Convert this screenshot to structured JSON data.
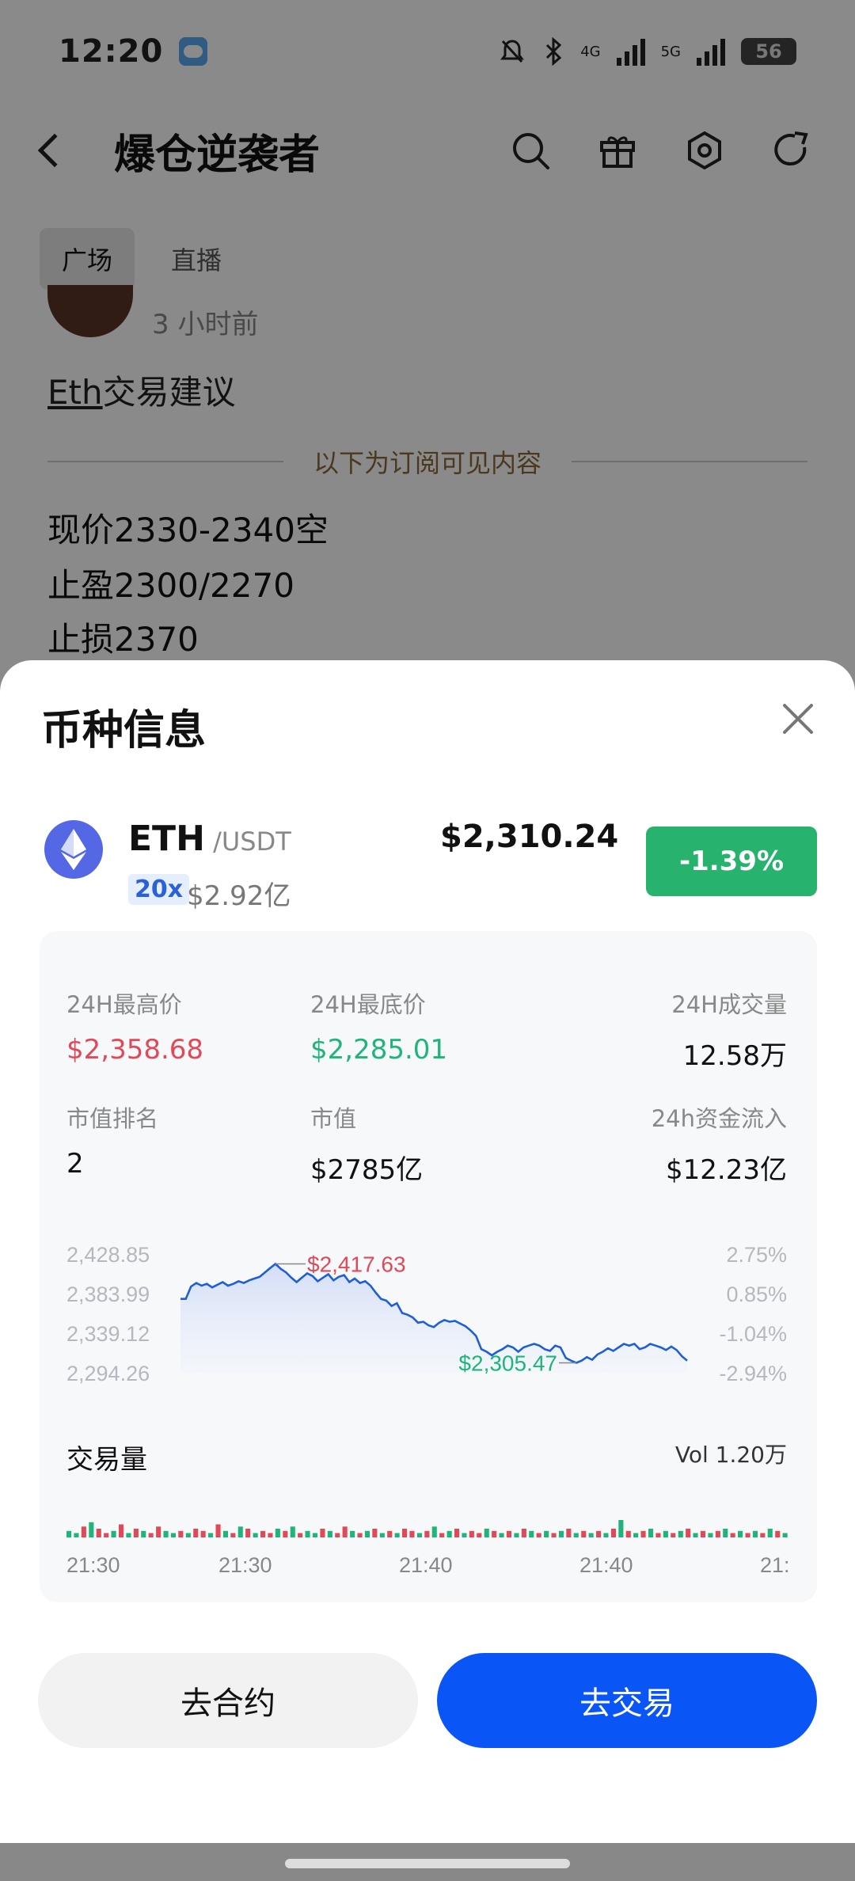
{
  "status_bar": {
    "time": "12:20",
    "battery": "56",
    "net1": "4G",
    "net2": "5G"
  },
  "nav": {
    "title": "爆仓逆袭者"
  },
  "tabs": [
    {
      "label": "广场"
    },
    {
      "label": "直播"
    }
  ],
  "post": {
    "time_ago": "3 小时前",
    "title_underlined": "Eth",
    "title_rest": "交易建议",
    "divider_text": "以下为订阅可见内容",
    "lines": [
      "现价2330-2340空",
      "止盈2300/2270",
      "止损2370"
    ]
  },
  "sheet": {
    "title": "币种信息",
    "coin": {
      "symbol": "ETH",
      "pair": " /USDT",
      "leverage": "20x",
      "market_cap_short": "$2.92亿",
      "price": "$2,310.24",
      "change": "-1.39%"
    },
    "stats": {
      "high_label": "24H最高价",
      "high_value": "$2,358.68",
      "low_label": "24H最底价",
      "low_value": "$2,285.01",
      "vol_label": "24H成交量",
      "vol_value": "12.58万",
      "rank_label": "市值排名",
      "rank_value": "2",
      "mcap_label": "市值",
      "mcap_value": "$2785亿",
      "inflow_label": "24h资金流入",
      "inflow_value": "$12.23亿"
    },
    "volume": {
      "label": "交易量",
      "value": "Vol 1.20万"
    },
    "buttons": {
      "contract": "去合约",
      "trade": "去交易"
    }
  },
  "chart_data": {
    "type": "line",
    "y_ticks_left": [
      "2,428.85",
      "2,383.99",
      "2,339.12",
      "2,294.26"
    ],
    "y_ticks_right": [
      "2.75%",
      "0.85%",
      "-1.04%",
      "-2.94%"
    ],
    "ylim": [
      2294.26,
      2428.85
    ],
    "max_label": "$2,417.63",
    "min_label": "$2,305.47",
    "max_value": 2417.63,
    "min_value": 2305.47,
    "x_ticks": [
      "21:30",
      "21:30",
      "21:40",
      "21:40",
      "21:"
    ],
    "series": [
      {
        "values": [
          2378,
          2378,
          2392,
          2396,
          2393,
          2395,
          2391,
          2394,
          2397,
          2393,
          2395,
          2398,
          2396,
          2399,
          2401,
          2403,
          2408,
          2413,
          2417.63,
          2412,
          2408,
          2402,
          2397,
          2402,
          2407,
          2404,
          2398,
          2402,
          2406,
          2399,
          2403,
          2405,
          2397,
          2401,
          2396,
          2398,
          2393,
          2385,
          2378,
          2376,
          2370,
          2373,
          2362,
          2360,
          2357,
          2351,
          2352,
          2348,
          2346,
          2351,
          2354,
          2352,
          2353,
          2350,
          2347,
          2342,
          2336,
          2321,
          2318,
          2314,
          2318,
          2321,
          2325,
          2323,
          2318,
          2323,
          2325,
          2327,
          2325,
          2321,
          2319,
          2325,
          2323,
          2311,
          2308,
          2305.47,
          2308,
          2312,
          2309,
          2315,
          2318,
          2322,
          2319,
          2323,
          2327,
          2325,
          2327,
          2321,
          2323,
          2327,
          2325,
          2323,
          2320,
          2324,
          2320,
          2313,
          2308
        ]
      }
    ],
    "volumes": [
      3,
      2,
      5,
      7,
      4,
      2,
      3,
      6,
      2,
      4,
      3,
      2,
      5,
      3,
      2,
      3,
      2,
      4,
      3,
      2,
      6,
      3,
      2,
      5,
      4,
      2,
      3,
      2,
      4,
      3,
      5,
      2,
      3,
      2,
      4,
      3,
      2,
      5,
      3,
      2,
      3,
      4,
      2,
      3,
      2,
      4,
      3,
      2,
      3,
      5,
      2,
      3,
      4,
      2,
      3,
      2,
      4,
      3,
      2,
      3,
      2,
      4,
      3,
      2,
      3,
      2,
      3,
      4,
      2,
      3,
      2,
      3,
      2,
      4,
      8,
      3,
      2,
      3,
      4,
      2,
      3,
      2,
      3,
      4,
      2,
      3,
      2,
      3,
      4,
      2,
      3,
      2,
      3,
      2,
      4,
      3,
      2
    ],
    "volume_directions": [
      "g",
      "g",
      "r",
      "g",
      "r",
      "r",
      "g",
      "r",
      "g",
      "r",
      "g",
      "r",
      "r",
      "g",
      "g",
      "r",
      "g",
      "r",
      "r",
      "g",
      "r",
      "g",
      "r",
      "g",
      "r",
      "g",
      "r",
      "r",
      "g",
      "r",
      "g",
      "r",
      "g",
      "g",
      "r",
      "g",
      "r",
      "r",
      "g",
      "r",
      "g",
      "r",
      "g",
      "r",
      "g",
      "r",
      "r",
      "g",
      "r",
      "g",
      "r",
      "g",
      "r",
      "g",
      "r",
      "r",
      "g",
      "r",
      "g",
      "r",
      "g",
      "r",
      "g",
      "r",
      "g",
      "r",
      "g",
      "r",
      "g",
      "r",
      "g",
      "r",
      "g",
      "r",
      "g",
      "r",
      "g",
      "r",
      "g",
      "r",
      "g",
      "r",
      "g",
      "r",
      "g",
      "r",
      "g",
      "r",
      "g",
      "r",
      "g",
      "r",
      "g",
      "r",
      "g",
      "r",
      "g"
    ],
    "colors": {
      "line": "#1e5fd6",
      "up": "#1fb57a",
      "down": "#e04a58"
    }
  }
}
